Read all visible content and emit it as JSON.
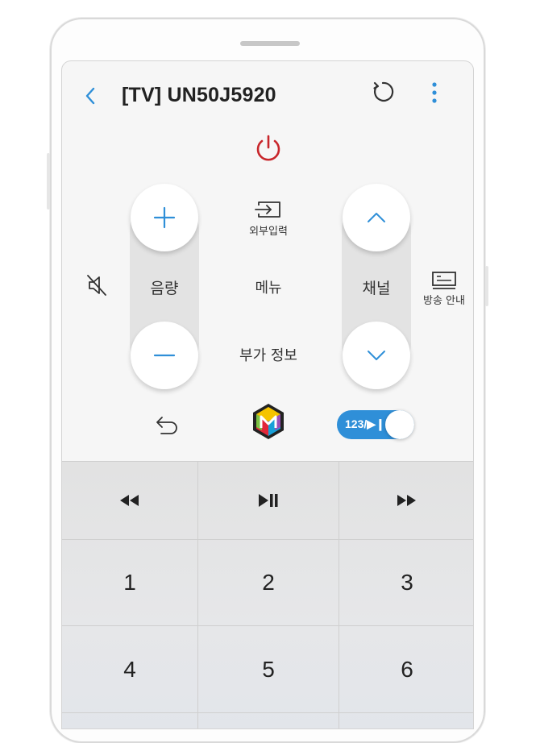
{
  "header": {
    "back_icon": "chevron-left-icon",
    "title": "[TV] UN50J5920",
    "refresh_icon": "refresh-icon",
    "more_icon": "more-vertical-icon"
  },
  "power": {
    "icon": "power-icon",
    "color": "#c8262b"
  },
  "volume": {
    "label": "음량",
    "plus_icon": "plus-icon",
    "minus_icon": "minus-icon"
  },
  "channel": {
    "label": "채널",
    "up_icon": "chevron-up-icon",
    "down_icon": "chevron-down-icon"
  },
  "center": {
    "source_label": "외부입력",
    "menu_label": "메뉴",
    "info_label": "부가 정보"
  },
  "side": {
    "mute_icon": "mute-icon",
    "guide_label": "방송 안내"
  },
  "bottom_row": {
    "back_icon": "return-icon",
    "smart_hub_icon": "smart-hub-icon",
    "toggle_label": "123/▶❙❙"
  },
  "keypad": {
    "media": [
      "rewind-icon",
      "play-pause-icon",
      "fast-forward-icon"
    ],
    "digits": [
      "1",
      "2",
      "3",
      "4",
      "5",
      "6"
    ]
  },
  "colors": {
    "accent": "#2f8fd8",
    "power": "#c8262b"
  }
}
